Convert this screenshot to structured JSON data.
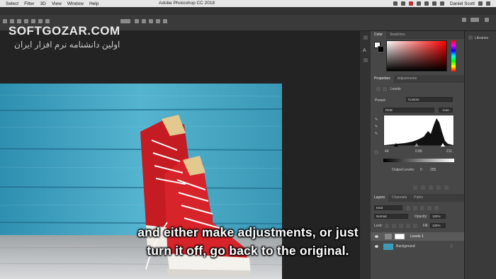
{
  "menubar": {
    "items": [
      "Select",
      "Filter",
      "3D",
      "View",
      "Window",
      "Help"
    ],
    "app_title": "Adobe Photoshop CC 2018",
    "user": "Daniel Scott"
  },
  "watermark": {
    "brand": "SOFTGOZAR.COM",
    "tagline": "اولین دانشنامه نرم افزار ایران"
  },
  "color_panel": {
    "tabs": [
      "Color",
      "Swatches"
    ]
  },
  "properties_panel": {
    "tabs": [
      "Properties",
      "Adjustments"
    ],
    "adjustment_name": "Levels",
    "preset_label": "Preset:",
    "preset_value": "Custom",
    "channel_value": "RGB",
    "auto_label": "Auto",
    "input_black": "44",
    "input_mid": "0.86",
    "input_white": "211",
    "output_label": "Output Levels:",
    "output_black": "0",
    "output_white": "255"
  },
  "layers_panel": {
    "tabs": [
      "Layers",
      "Channels",
      "Paths"
    ],
    "kind_label": "Kind",
    "blend_mode": "Normal",
    "opacity_label": "Opacity:",
    "opacity_value": "100%",
    "lock_label": "Lock:",
    "fill_label": "Fill:",
    "fill_value": "100%",
    "layers": [
      {
        "name": "Levels 1"
      },
      {
        "name": "Background"
      }
    ]
  },
  "libraries": {
    "label": "Libraries"
  },
  "subtitle": {
    "line1": "and either make adjustments, or just",
    "line2": "turn it off, go back to the original."
  },
  "colors": {
    "accent": "#e0242c",
    "wood_blue": "#3b9bb8"
  }
}
